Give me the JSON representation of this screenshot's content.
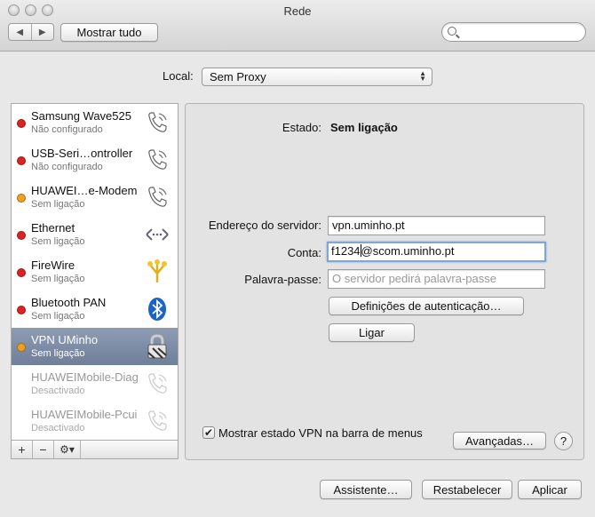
{
  "window": {
    "title": "Rede"
  },
  "toolbar": {
    "back": "◀",
    "forward": "▶",
    "show_all": "Mostrar tudo",
    "search_placeholder": ""
  },
  "location": {
    "label": "Local:",
    "value": "Sem Proxy"
  },
  "services": [
    {
      "name": "Samsung Wave525",
      "status": "Não configurado",
      "color": "#d22",
      "icon": "phone-icon"
    },
    {
      "name": "USB-Seri…ontroller",
      "status": "Não configurado",
      "color": "#d22",
      "icon": "phone-icon"
    },
    {
      "name": "HUAWEI…e-Modem",
      "status": "Sem ligação",
      "color": "#f0a020",
      "icon": "phone-icon"
    },
    {
      "name": "Ethernet",
      "status": "Sem ligação",
      "color": "#d22",
      "icon": "ethernet-icon"
    },
    {
      "name": "FireWire",
      "status": "Sem ligação",
      "color": "#d22",
      "icon": "firewire-icon"
    },
    {
      "name": "Bluetooth PAN",
      "status": "Sem ligação",
      "color": "#d22",
      "icon": "bluetooth-icon"
    },
    {
      "name": "VPN UMinho",
      "status": "Sem ligação",
      "color": "#f0a020",
      "icon": "lock-icon"
    },
    {
      "name": "HUAWEIMobile-Diag",
      "status": "Desactivado",
      "color": "",
      "icon": "phone-icon"
    },
    {
      "name": "HUAWEIMobile-Pcui",
      "status": "Desactivado",
      "color": "",
      "icon": "phone-icon"
    }
  ],
  "sidebar_bottom": {
    "add": "+",
    "remove": "−",
    "gear": "⚙▾"
  },
  "detail": {
    "status_label": "Estado:",
    "status_value": "Sem ligação",
    "server_label": "Endereço do servidor:",
    "server_value": "vpn.uminho.pt",
    "account_label": "Conta:",
    "account_before": "f1234",
    "account_after": "@scom.uminho.pt",
    "password_label": "Palavra-passe:",
    "password_placeholder": "O servidor pedirá palavra-passe",
    "auth_button": "Definições de autenticação…",
    "connect_button": "Ligar",
    "show_vpn_label": "Mostrar estado VPN na barra de menus",
    "show_vpn_checked": "✔",
    "advanced_button": "Avançadas…",
    "help": "?"
  },
  "footer": {
    "assistant": "Assistente…",
    "revert": "Restabelecer",
    "apply": "Aplicar"
  }
}
